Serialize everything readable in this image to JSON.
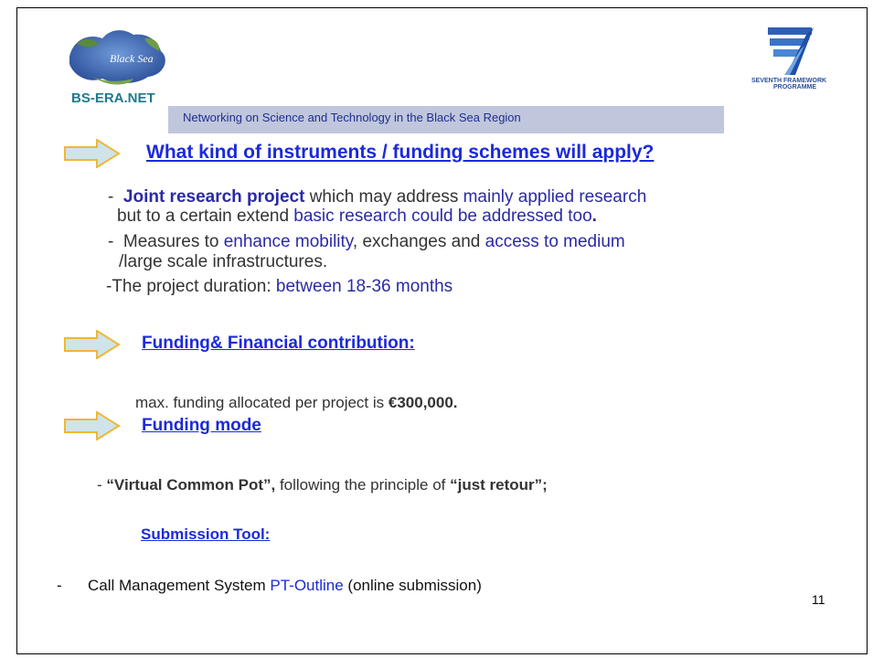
{
  "header": {
    "logo_left_text": "Black Sea",
    "logo_left_caption": "BS-ERA.NET",
    "logo_right_text": "SEVENTH FRAMEWORK PROGRAMME",
    "band_text": "Networking on Science and Technology in the Black Sea Region"
  },
  "section1": {
    "heading": "What kind of instruments / funding schemes will apply?",
    "b1_dash": "-",
    "b1_bold": "Joint research project",
    "b1_t1": " which may address ",
    "b1_blue1": "mainly applied research",
    "b1_t2": "but to a certain extend ",
    "b1_blue2": "basic research could be addressed too",
    "b1_end": ".",
    "b2_dash": "-",
    "b2_t1": "Measures to ",
    "b2_blue1": "enhance mobility",
    "b2_t2": ",  exchanges and ",
    "b2_blue2": "access to medium",
    "b2_line2": "/large scale infrastructures.",
    "b3_t1": "-The project duration: ",
    "b3_blue": "between 18-36 months"
  },
  "section2": {
    "heading": "Funding& Financial contribution:",
    "text": "max. funding allocated per project is ",
    "amount": "€300,000."
  },
  "section3": {
    "heading": "Funding mode",
    "dash": "-",
    "bold1": "“Virtual Common Pot”,",
    "text": " following the principle of ",
    "bold2": "“just retour”;"
  },
  "section4": {
    "heading": "Submission Tool:",
    "dash": "-",
    "t1": "Call Management System ",
    "blue": "PT-Outline",
    "t2": " (online submission)"
  },
  "page_number": "11"
}
